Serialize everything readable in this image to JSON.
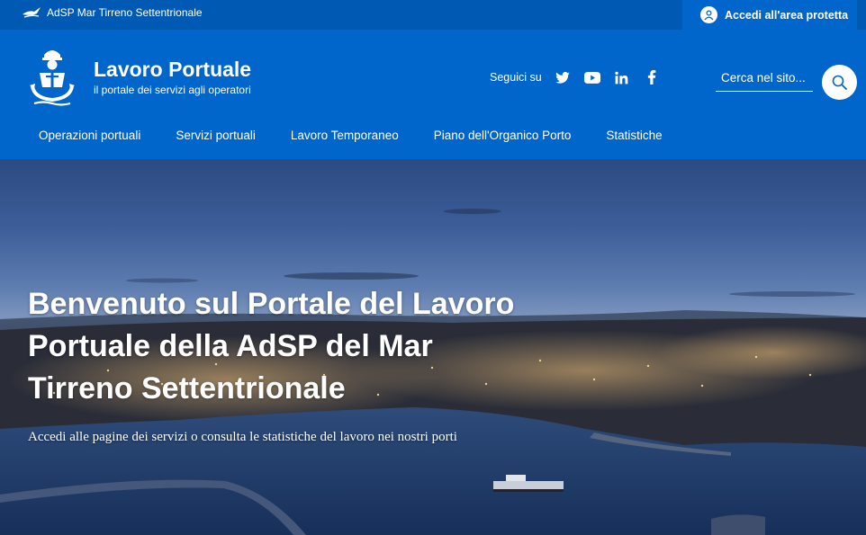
{
  "topbar": {
    "brand": "AdSP Mar Tirreno Settentrionale",
    "login_label": "Accedi all'area protetta"
  },
  "header": {
    "title": "Lavoro Portuale",
    "subtitle": "il portale dei servizi agli operatori",
    "social_label": "Seguici su",
    "social_icons": [
      "twitter-icon",
      "youtube-icon",
      "linkedin-icon",
      "facebook-icon"
    ],
    "search_placeholder": "Cerca nel sito..."
  },
  "nav": {
    "items": [
      {
        "label": "Operazioni portuali"
      },
      {
        "label": "Servizi portuali"
      },
      {
        "label": "Lavoro Temporaneo"
      },
      {
        "label": "Piano dell'Organico Porto"
      },
      {
        "label": "Statistiche"
      }
    ]
  },
  "hero": {
    "title": "Benvenuto sul Portale del Lavoro Portuale della AdSP del Mar Tirreno Settentrionale",
    "subtitle": "Accedi alle pagine dei servizi o consulta le statistiche del lavoro nei nostri porti"
  },
  "colors": {
    "topbar": "#0059b3",
    "header": "#0066cc",
    "text": "#ffffff"
  }
}
